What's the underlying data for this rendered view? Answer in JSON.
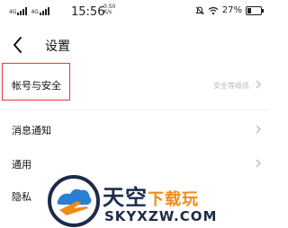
{
  "status_bar": {
    "signal_1_tag": "4G",
    "signal_2_tag": "4G",
    "time": "15:56",
    "net_speed_value": "0.50",
    "net_speed_unit": "K/s",
    "battery_percent": "27%",
    "battery_level": 0.27
  },
  "nav": {
    "title": "设置"
  },
  "settings": {
    "account_security": {
      "label": "帐号与安全",
      "value": "安全等级低"
    },
    "notifications": {
      "label": "消息通知"
    },
    "general": {
      "label": "通用"
    },
    "privacy": {
      "label": "隐私"
    }
  },
  "watermark": {
    "cn_main": "天空",
    "cn_accent": "下载玩",
    "domain": "SKYXZW.COM"
  },
  "colors": {
    "highlight": "#e53935",
    "watermark_navy": "#1c2b4a",
    "watermark_orange": "#f08a18"
  }
}
